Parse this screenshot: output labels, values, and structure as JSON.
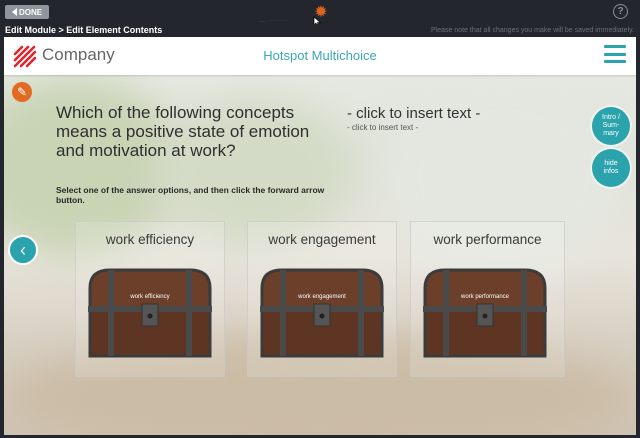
{
  "topbar": {
    "done_label": "DONE",
    "gear_icon": "gear-icon",
    "help_label": "?",
    "tiny_text": "—— ·················"
  },
  "subbar": {
    "breadcrumb": "Edit Module > Edit Element Contents",
    "note": "Please note that all changes you make will be saved immediately."
  },
  "header": {
    "company": "Company",
    "title": "Hotspot Multichoice"
  },
  "content": {
    "question": "Which of the following concepts means a positive state of emotion and motivation at work?",
    "instruction": "Select one of the answer options, and then click the forward arrow button.",
    "insert_big": "- click to insert text -",
    "insert_small": "- click to insert text -",
    "intro_label": "Intro / Sum-mary",
    "hide_label": "hide infos"
  },
  "options": [
    {
      "title": "work efficiency",
      "chest_label": "work efficiency"
    },
    {
      "title": "work engagement",
      "chest_label": "work engagement"
    },
    {
      "title": "work performance",
      "chest_label": "work performance"
    }
  ],
  "colors": {
    "accent": "#2ba3ad",
    "orange": "#e16b22",
    "topbar": "#23272d"
  }
}
